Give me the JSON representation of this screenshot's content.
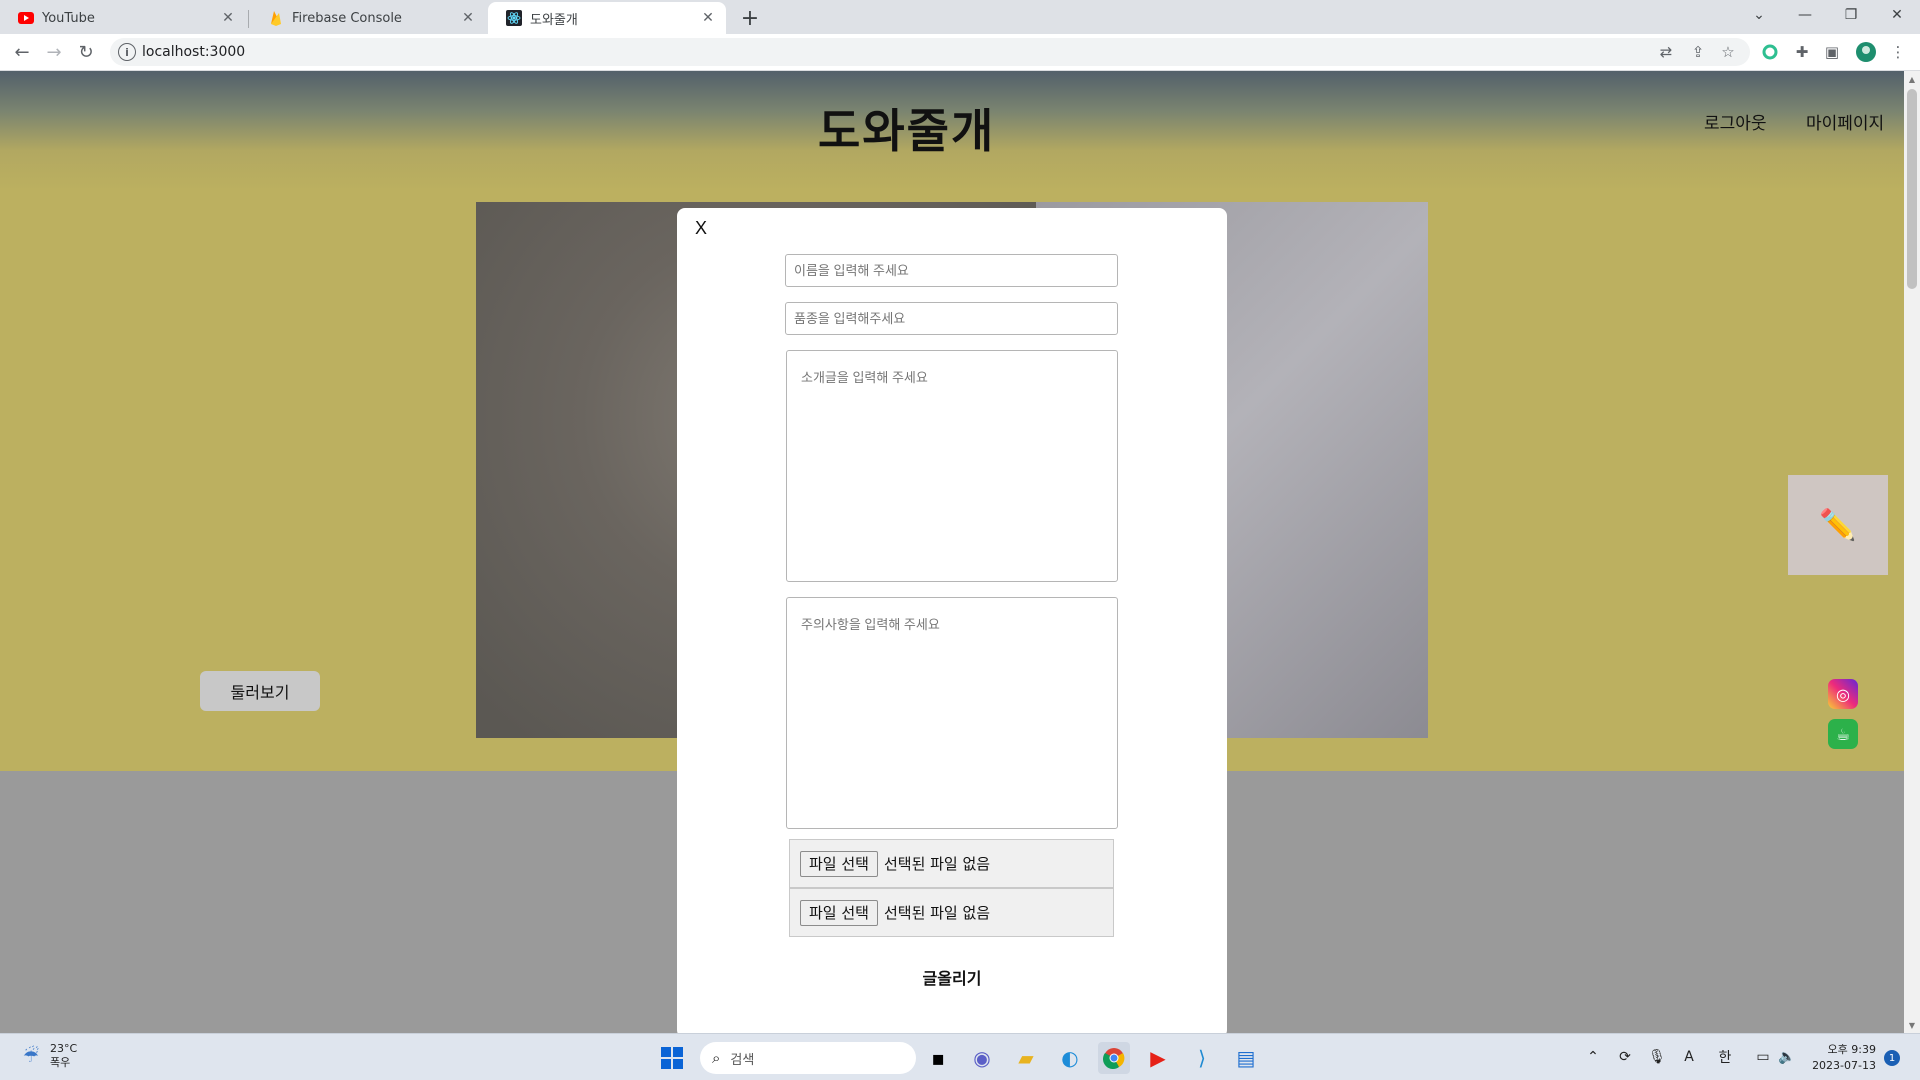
{
  "browser": {
    "tabs": [
      {
        "label": "YouTube",
        "icon": "youtube-icon"
      },
      {
        "label": "Firebase Console",
        "icon": "firebase-icon"
      },
      {
        "label": "도와줄개",
        "icon": "react-icon"
      }
    ],
    "active_tab": 2,
    "url": "localhost:3000"
  },
  "page": {
    "logo": "도와줄개",
    "nav": {
      "logout": "로그아웃",
      "mypage": "마이페이지"
    },
    "browse_button": "둘러보기"
  },
  "modal": {
    "close_label": "X",
    "name_placeholder": "이름을 입력해 주세요",
    "breed_placeholder": "품종을 입력해주세요",
    "intro_placeholder": "소개글을 입력해 주세요",
    "caution_placeholder": "주의사항을 입력해 주세요",
    "file_button": "파일 선택",
    "file_status": "선택된 파일 없음",
    "submit_label": "글올리기"
  },
  "taskbar": {
    "weather_temp": "23°C",
    "weather_desc": "폭우",
    "search_label": "검색",
    "time": "오후 9:39",
    "date": "2023-07-13",
    "notifications": "1",
    "ime_lang": "한"
  },
  "colors": {
    "hero_bg": "#bcb060",
    "lower_bg": "#9a9a9a",
    "modal_bg": "#ffffff"
  }
}
